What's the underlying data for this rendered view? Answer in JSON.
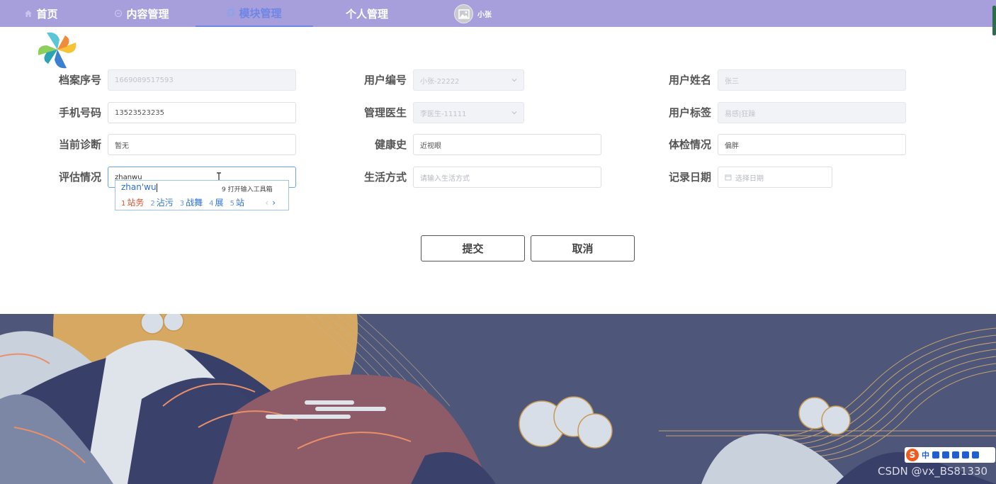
{
  "nav": {
    "items": [
      {
        "label": "首页",
        "icon": "home-icon"
      },
      {
        "label": "内容管理",
        "icon": "content-icon"
      },
      {
        "label": "模块管理",
        "icon": "module-icon",
        "active": true
      },
      {
        "label": "个人管理",
        "icon": ""
      }
    ],
    "user": {
      "name": "小张",
      "avatar": "image-icon"
    },
    "active_color": "#6e86e6",
    "bar_color": "#a79fdc"
  },
  "form": {
    "rows": [
      [
        {
          "label": "档案序号",
          "value": "1669089517593",
          "state": "disabled"
        },
        {
          "label": "用户编号",
          "value": "小张-22222",
          "state": "disabled-select"
        },
        {
          "label": "用户姓名",
          "value": "张三",
          "state": "disabled"
        }
      ],
      [
        {
          "label": "手机号码",
          "value": "13523523235",
          "state": "normal"
        },
        {
          "label": "管理医生",
          "value": "李医生-11111",
          "state": "disabled-select"
        },
        {
          "label": "用户标签",
          "value": "易感|狂躁",
          "state": "disabled"
        }
      ],
      [
        {
          "label": "当前诊断",
          "value": "暂无",
          "state": "normal"
        },
        {
          "label": "健康史",
          "value": "近视眼",
          "state": "normal"
        },
        {
          "label": "体检情况",
          "value": "偏胖",
          "state": "normal"
        }
      ],
      [
        {
          "label": "评估情况",
          "value": "zhanwu",
          "state": "focus"
        },
        {
          "label": "生活方式",
          "placeholder": "请输入生活方式",
          "state": "placeholder"
        },
        {
          "label": "记录日期",
          "placeholder": "选择日期",
          "state": "date"
        }
      ]
    ]
  },
  "ime": {
    "pinyin": "zhan'wu",
    "tool_hint": "9 打开输入工具箱",
    "candidates": [
      {
        "n": "1",
        "text": "站务"
      },
      {
        "n": "2",
        "text": "沾污"
      },
      {
        "n": "3",
        "text": "战舞"
      },
      {
        "n": "4",
        "text": "展"
      },
      {
        "n": "5",
        "text": "站"
      }
    ]
  },
  "buttons": {
    "submit": "提交",
    "cancel": "取消"
  },
  "watermark": "CSDN @vx_BS81330",
  "ime_bar": {
    "logo": "S",
    "mode": "中"
  }
}
